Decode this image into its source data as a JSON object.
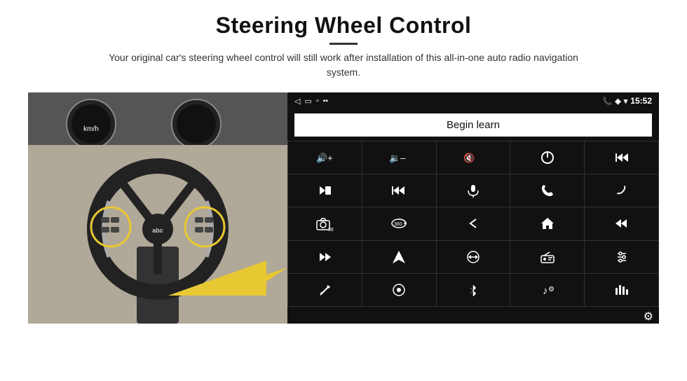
{
  "header": {
    "title": "Steering Wheel Control",
    "divider": true,
    "subtitle": "Your original car's steering wheel control will still work after installation of this all-in-one auto radio navigation system."
  },
  "status_bar": {
    "back_icon": "◁",
    "home_rect": "▭",
    "square_icon": "▫",
    "signal_icon": "📶",
    "phone_icon": "📞",
    "location_icon": "◈",
    "wifi_icon": "▲",
    "time": "15:52"
  },
  "begin_learn": {
    "label": "Begin learn"
  },
  "icons": [
    {
      "id": "vol-up",
      "symbol": "🔊+"
    },
    {
      "id": "vol-down",
      "symbol": "🔉–"
    },
    {
      "id": "vol-mute",
      "symbol": "🔇"
    },
    {
      "id": "power",
      "symbol": "⏻"
    },
    {
      "id": "prev-track",
      "symbol": "⏮"
    },
    {
      "id": "next-track",
      "symbol": "⏭"
    },
    {
      "id": "ff-prev",
      "symbol": "⏪"
    },
    {
      "id": "mic",
      "symbol": "🎤"
    },
    {
      "id": "phone",
      "symbol": "📞"
    },
    {
      "id": "hang-up",
      "symbol": "📵"
    },
    {
      "id": "cam",
      "symbol": "📷"
    },
    {
      "id": "360",
      "symbol": "360°"
    },
    {
      "id": "back",
      "symbol": "↩"
    },
    {
      "id": "home",
      "symbol": "⌂"
    },
    {
      "id": "skip-back",
      "symbol": "⏮"
    },
    {
      "id": "skip-fwd",
      "symbol": "⏭"
    },
    {
      "id": "nav",
      "symbol": "▶"
    },
    {
      "id": "eq",
      "symbol": "⇌"
    },
    {
      "id": "radio",
      "symbol": "📻"
    },
    {
      "id": "equalizer",
      "symbol": "🎚"
    },
    {
      "id": "pen",
      "symbol": "✏"
    },
    {
      "id": "settings2",
      "symbol": "⊙"
    },
    {
      "id": "bluetooth",
      "symbol": "✦"
    },
    {
      "id": "music",
      "symbol": "♪"
    },
    {
      "id": "waves",
      "symbol": "▊"
    }
  ],
  "settings": {
    "icon": "⚙"
  }
}
